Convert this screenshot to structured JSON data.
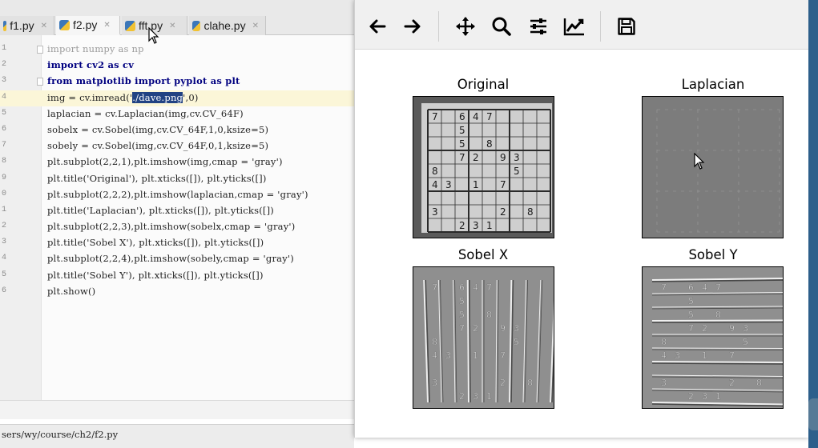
{
  "tabs": [
    {
      "label": "f1.py",
      "active": false
    },
    {
      "label": "f2.py",
      "active": true
    },
    {
      "label": "fft.py",
      "active": false
    },
    {
      "label": "clahe.py",
      "active": false
    }
  ],
  "editor": {
    "lines": [
      {
        "n": "1",
        "code": "import numpy as np"
      },
      {
        "n": "2",
        "code": "import cv2 as cv"
      },
      {
        "n": "3",
        "code": "from matplotlib import pyplot as plt"
      },
      {
        "n": "4",
        "code_pre": "img = cv.imread('",
        "code_sel": "./dave.png",
        "code_post": "',0)"
      },
      {
        "n": "5",
        "code": "laplacian = cv.Laplacian(img,cv.CV_64F)"
      },
      {
        "n": "6",
        "code": "sobelx = cv.Sobel(img,cv.CV_64F,1,0,ksize=5)"
      },
      {
        "n": "7",
        "code": "sobely = cv.Sobel(img,cv.CV_64F,0,1,ksize=5)"
      },
      {
        "n": "8",
        "code": "plt.subplot(2,2,1),plt.imshow(img,cmap = 'gray')"
      },
      {
        "n": "9",
        "code": "plt.title('Original'), plt.xticks([]), plt.yticks([])"
      },
      {
        "n": "0",
        "code": "plt.subplot(2,2,2),plt.imshow(laplacian,cmap = 'gray')"
      },
      {
        "n": "1",
        "code": "plt.title('Laplacian'), plt.xticks([]), plt.yticks([])"
      },
      {
        "n": "2",
        "code": "plt.subplot(2,2,3),plt.imshow(sobelx,cmap = 'gray')"
      },
      {
        "n": "3",
        "code": "plt.title('Sobel X'), plt.xticks([]), plt.yticks([])"
      },
      {
        "n": "4",
        "code": "plt.subplot(2,2,4),plt.imshow(sobely,cmap = 'gray')"
      },
      {
        "n": "5",
        "code": "plt.title('Sobel Y'), plt.xticks([]), plt.yticks([])"
      },
      {
        "n": "6",
        "code": "plt.show()"
      }
    ]
  },
  "statusbar": {
    "path": "sers/wy/course/ch2/f2.py"
  },
  "figure_toolbar": {
    "buttons": [
      "back-arrow-icon",
      "forward-arrow-icon",
      "pan-move-icon",
      "zoom-magnifier-icon",
      "subplots-config-icon",
      "edit-axis-curve-icon",
      "save-floppy-icon"
    ]
  },
  "figure": {
    "subplots": [
      {
        "title": "Original"
      },
      {
        "title": "Laplacian"
      },
      {
        "title": "Sobel X"
      },
      {
        "title": "Sobel Y"
      }
    ],
    "sudoku_rows": [
      [
        "7",
        "",
        "6",
        "4",
        "7",
        "",
        "",
        "",
        ""
      ],
      [
        "",
        "",
        "5",
        "",
        "",
        "",
        "",
        "",
        ""
      ],
      [
        "",
        "",
        "5",
        "",
        "8",
        "",
        "",
        "",
        ""
      ],
      [
        "",
        "",
        "7",
        "2",
        "",
        "9",
        "3",
        "",
        ""
      ],
      [
        "8",
        "",
        "",
        "",
        "",
        "",
        "5",
        "",
        ""
      ],
      [
        "4",
        "3",
        "",
        "1",
        "",
        "7",
        "",
        "",
        ""
      ],
      [
        "",
        "",
        "",
        "",
        "",
        "",
        "",
        "",
        ""
      ],
      [
        "3",
        "",
        "",
        "",
        "",
        "2",
        "",
        "8",
        ""
      ],
      [
        "",
        "",
        "2",
        "3",
        "1",
        "",
        "",
        "",
        ""
      ]
    ]
  },
  "colors": {
    "editor_bg": "#fbfbfb",
    "selection": "#214283",
    "keyword": "#000080",
    "string": "#0b7a0b",
    "taskbar": "#2d5f8b"
  }
}
